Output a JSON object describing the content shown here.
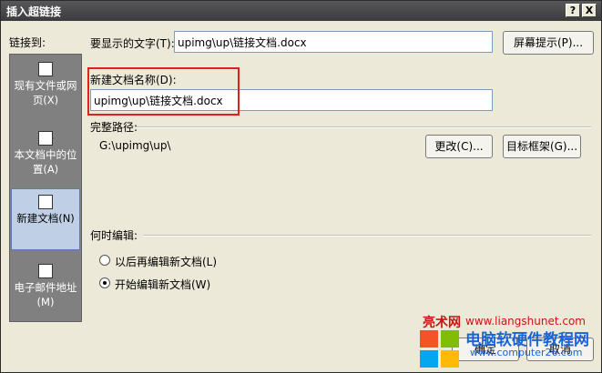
{
  "title": "插入超链接",
  "titlebar": {
    "help": "?",
    "close": "X"
  },
  "link_to_label": "链接到:",
  "sidebar": [
    {
      "label": "现有文件或网页(X)"
    },
    {
      "label": "本文档中的位置(A)"
    },
    {
      "label": "新建文档(N)"
    },
    {
      "label": "电子邮件地址(M)"
    }
  ],
  "display_text": {
    "label": "要显示的文字(T):",
    "value": "upimg\\up\\链接文档.docx"
  },
  "screentip_button": "屏幕提示(P)...",
  "new_doc_name": {
    "label": "新建文档名称(D):",
    "value": "upimg\\up\\链接文档.docx"
  },
  "full_path": {
    "label": "完整路径:",
    "value": "G:\\upimg\\up\\"
  },
  "change_button": "更改(C)...",
  "target_frame_button": "目标框架(G)...",
  "when_edit": {
    "label": "何时编辑:",
    "options": [
      "以后再编辑新文档(L)",
      "开始编辑新文档(W)"
    ]
  },
  "ok_button": "确定",
  "cancel_button": "取消",
  "watermark": {
    "brand": "亮术网",
    "url": "www.liangshunet.com",
    "site_name": "电脑软硬件教程网",
    "site_url": "www.computer26.com"
  }
}
